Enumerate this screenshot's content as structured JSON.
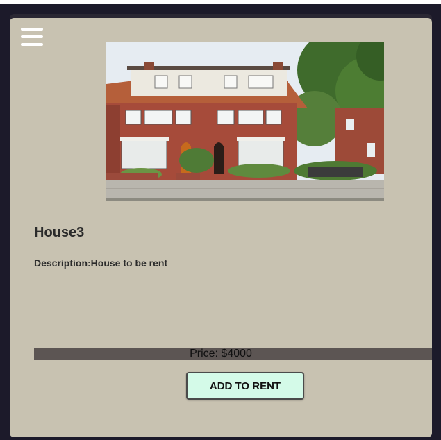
{
  "nav": {
    "menu_icon": "hamburger-menu-icon"
  },
  "listing": {
    "image_alt": "House3 photo",
    "title": "House3",
    "description": "Description:House to be rent",
    "price": "Price: $4000",
    "action_label": "ADD TO RENT"
  },
  "colors": {
    "card_bg": "#c8c2b1",
    "price_bar": "#5c5553",
    "button_bg": "#d4fae8",
    "page_bg": "#1c1a2a"
  }
}
